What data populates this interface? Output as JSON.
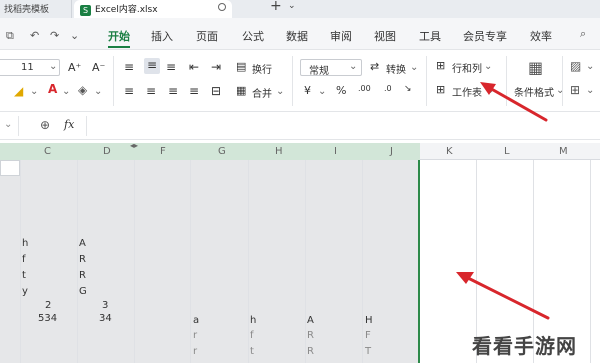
{
  "tabs": {
    "previous": "找稻壳模板",
    "active": "Excel内容.xlsx",
    "file_badge": "S",
    "new_tab": "+"
  },
  "menu": {
    "items": [
      "开始",
      "插入",
      "页面",
      "公式",
      "数据",
      "审阅",
      "视图",
      "工具",
      "会员专享",
      "效率"
    ],
    "active": "开始"
  },
  "ribbon": {
    "font_size": "11",
    "font_grow": "A⁺",
    "font_shrink": "A⁻",
    "wrap_label": "换行",
    "merge_label": "合并",
    "number_format": "常规",
    "convert_label": "转换",
    "rows_cols_label": "行和列",
    "worksheet_label": "工作表",
    "cond_format_label": "条件格式",
    "currency_symbol": "¥",
    "percent_symbol": "%",
    "dec_inc": ".00",
    "dec_dec": ".0"
  },
  "formula_bar": {
    "fx_label": "fx",
    "value": ""
  },
  "columns": [
    "C",
    "D",
    "F",
    "G",
    "H",
    "I",
    "J",
    "K",
    "L",
    "M"
  ],
  "cells": {
    "c_h": "h",
    "c_f": "f",
    "c_t": "t",
    "c_y": "y",
    "c_2": "2",
    "c_534": "534",
    "d_A": "A",
    "d_R1": "R",
    "d_R2": "R",
    "d_G": "G",
    "d_3": "3",
    "d_34": "34",
    "g_a": "a",
    "g_r1": "r",
    "g_r2": "r",
    "h_h": "h",
    "h_f": "f",
    "h_t": "t",
    "i_A": "A",
    "i_R1": "R",
    "i_R2": "R",
    "j_H": "H",
    "j_F": "F",
    "j_T": "T"
  },
  "watermark": "看看手游网",
  "colors": {
    "accent": "#1a7f43",
    "arrow": "#d8262c"
  }
}
